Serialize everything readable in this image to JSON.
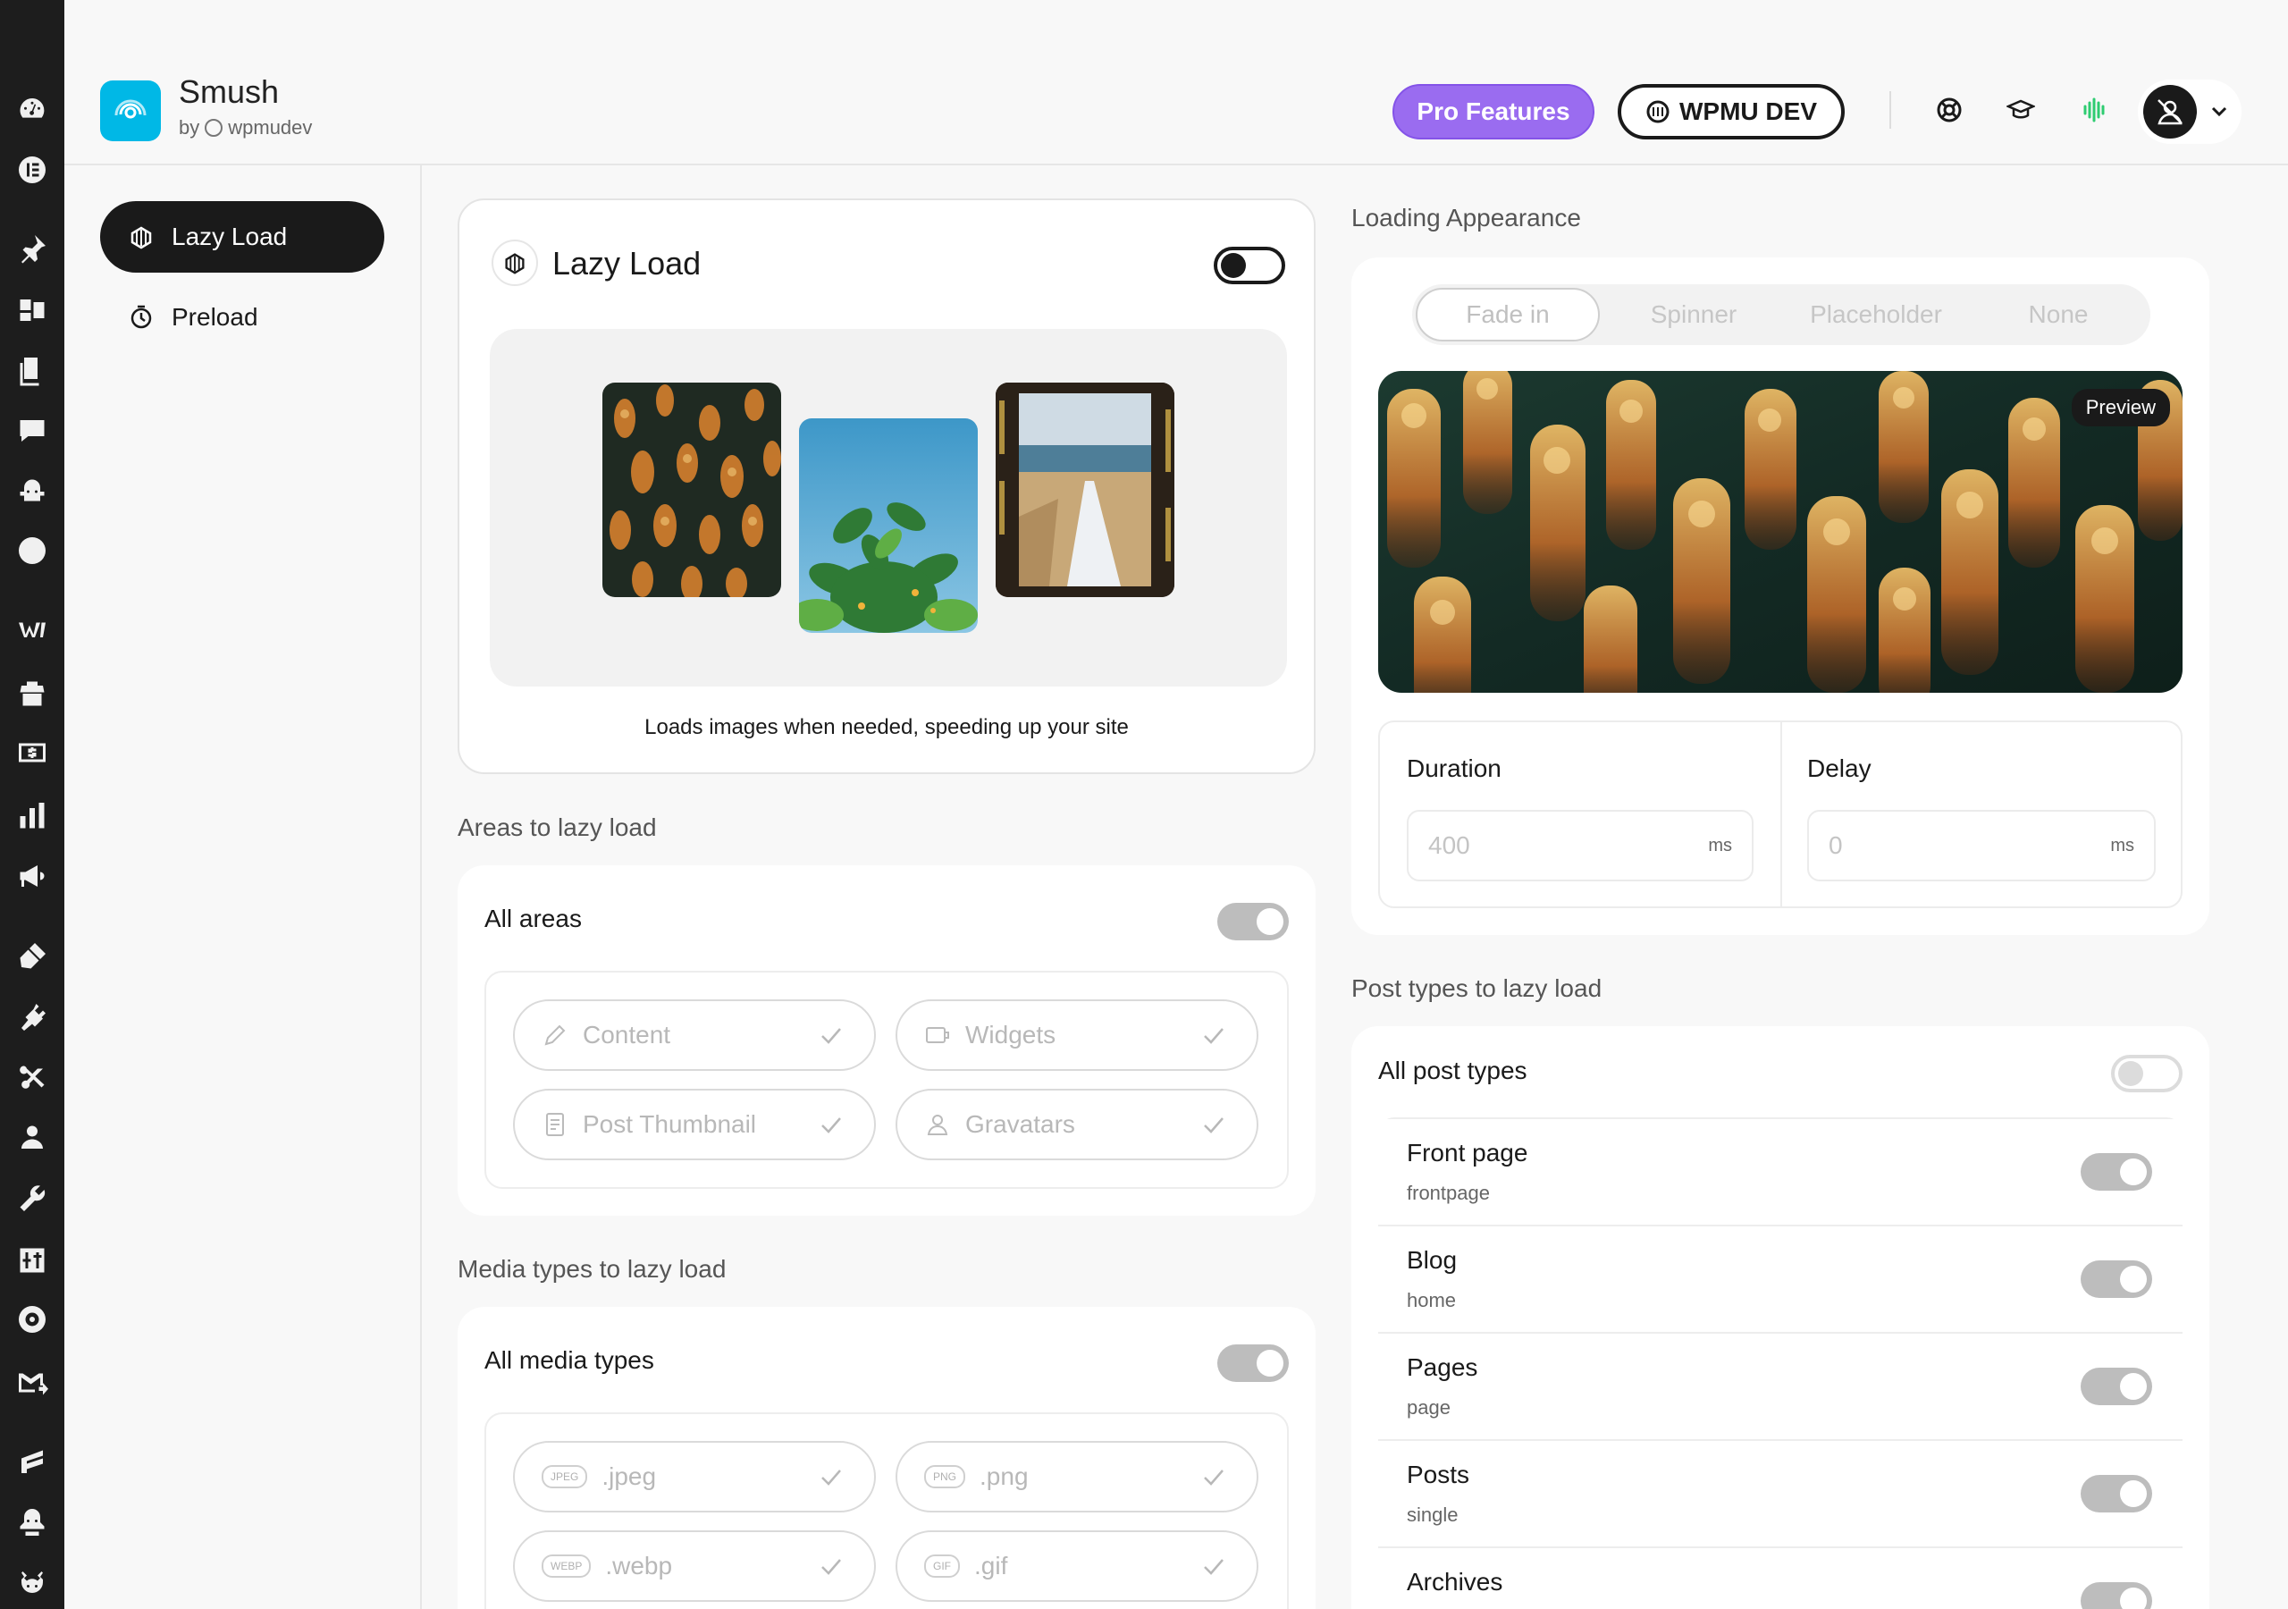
{
  "app": {
    "title": "Smush",
    "by_prefix": "by",
    "by_name": "wpmudev"
  },
  "header": {
    "pro_button": "Pro Features",
    "wpmu_button": "WPMU DEV"
  },
  "nav": [
    {
      "label": "Lazy Load",
      "active": true
    },
    {
      "label": "Preload",
      "active": false
    }
  ],
  "lazy_card": {
    "title": "Lazy Load",
    "enabled": false,
    "description": "Loads images when needed, speeding up your site"
  },
  "areas": {
    "section_label": "Areas to lazy load",
    "all_label": "All areas",
    "items": [
      {
        "label": "Content",
        "icon": "pencil-icon"
      },
      {
        "label": "Widgets",
        "icon": "widget-icon"
      },
      {
        "label": "Post Thumbnail",
        "icon": "document-icon"
      },
      {
        "label": "Gravatars",
        "icon": "user-icon"
      }
    ]
  },
  "media": {
    "section_label": "Media types to lazy load",
    "all_label": "All media types",
    "items": [
      {
        "label": ".jpeg",
        "badge": "JPEG"
      },
      {
        "label": ".png",
        "badge": "PNG"
      },
      {
        "label": ".webp",
        "badge": "WEBP"
      },
      {
        "label": ".gif",
        "badge": "GIF"
      }
    ]
  },
  "appearance": {
    "section_label": "Loading Appearance",
    "options": [
      "Fade in",
      "Spinner",
      "Placeholder",
      "None"
    ],
    "selected": "Fade in",
    "preview_label": "Preview",
    "duration_label": "Duration",
    "duration_placeholder": "400",
    "delay_label": "Delay",
    "delay_placeholder": "0",
    "unit": "ms"
  },
  "post_types": {
    "section_label": "Post types to lazy load",
    "all_label": "All post types",
    "items": [
      {
        "title": "Front page",
        "slug": "frontpage"
      },
      {
        "title": "Blog",
        "slug": "home"
      },
      {
        "title": "Pages",
        "slug": "page"
      },
      {
        "title": "Posts",
        "slug": "single"
      },
      {
        "title": "Archives",
        "slug": ""
      }
    ]
  },
  "colors": {
    "brand": "#00b8e6",
    "pro": "#9a6cf0",
    "dark": "#1a1a1a",
    "hub_green": "#2ecc71"
  }
}
